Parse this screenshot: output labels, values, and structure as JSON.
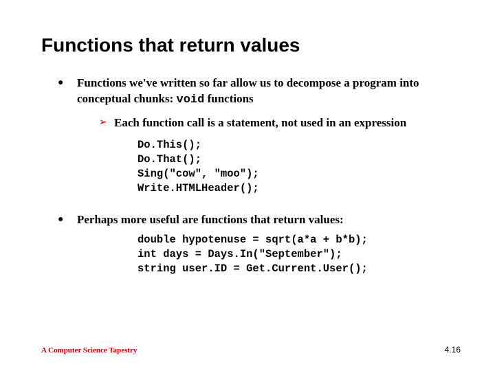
{
  "title": "Functions that return values",
  "bullet1": {
    "pre": "Functions we've written so far allow us to decompose a program into conceptual chunks: ",
    "code": "void",
    "post": " functions"
  },
  "sub1": "Each function call is a statement, not used in an expression",
  "code1": "Do.This();\nDo.That();\nSing(\"cow\", \"moo\");\nWrite.HTMLHeader();",
  "bullet2": "Perhaps more useful are functions that return values:",
  "code2": "double hypotenuse = sqrt(a*a + b*b);\nint days = Days.In(\"September\");\nstring user.ID = Get.Current.User();",
  "footer_left": "A Computer Science Tapestry",
  "footer_right": "4.16"
}
